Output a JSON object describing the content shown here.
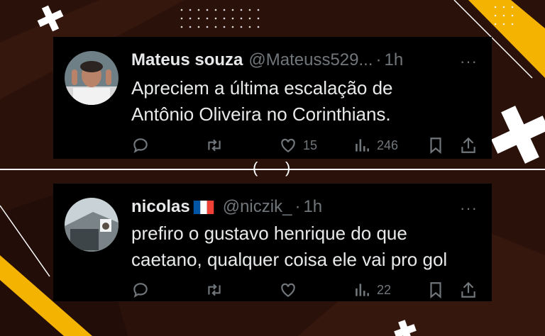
{
  "colors": {
    "background": "#2a120b",
    "card": "#000000",
    "text": "#e7e9ea",
    "muted": "#71767b",
    "accent_yellow": "#f5b301"
  },
  "tweets": [
    {
      "name": "Mateus souza",
      "handle": "@Mateuss529...",
      "separator": "·",
      "time": "1h",
      "more": "···",
      "text_lines": [
        "Apreciem a última escalação de",
        "Antônio Oliveira no Corinthians."
      ],
      "replies": "",
      "retweets": "",
      "likes": "15",
      "views": "246"
    },
    {
      "name": "nicolas",
      "flag": "france-flag",
      "handle": "@niczik_",
      "separator": "·",
      "time": "1h",
      "more": "···",
      "text_lines": [
        "prefiro o gustavo henrique do que",
        "caetano, qualquer coisa ele vai pro gol"
      ],
      "replies": "",
      "retweets": "",
      "likes": "",
      "views": "22"
    }
  ],
  "divider": {
    "left_paren": "(",
    "right_paren": ")"
  },
  "icons": [
    "reply-icon",
    "retweet-icon",
    "like-icon",
    "views-icon",
    "bookmark-icon",
    "share-icon",
    "more-icon"
  ]
}
